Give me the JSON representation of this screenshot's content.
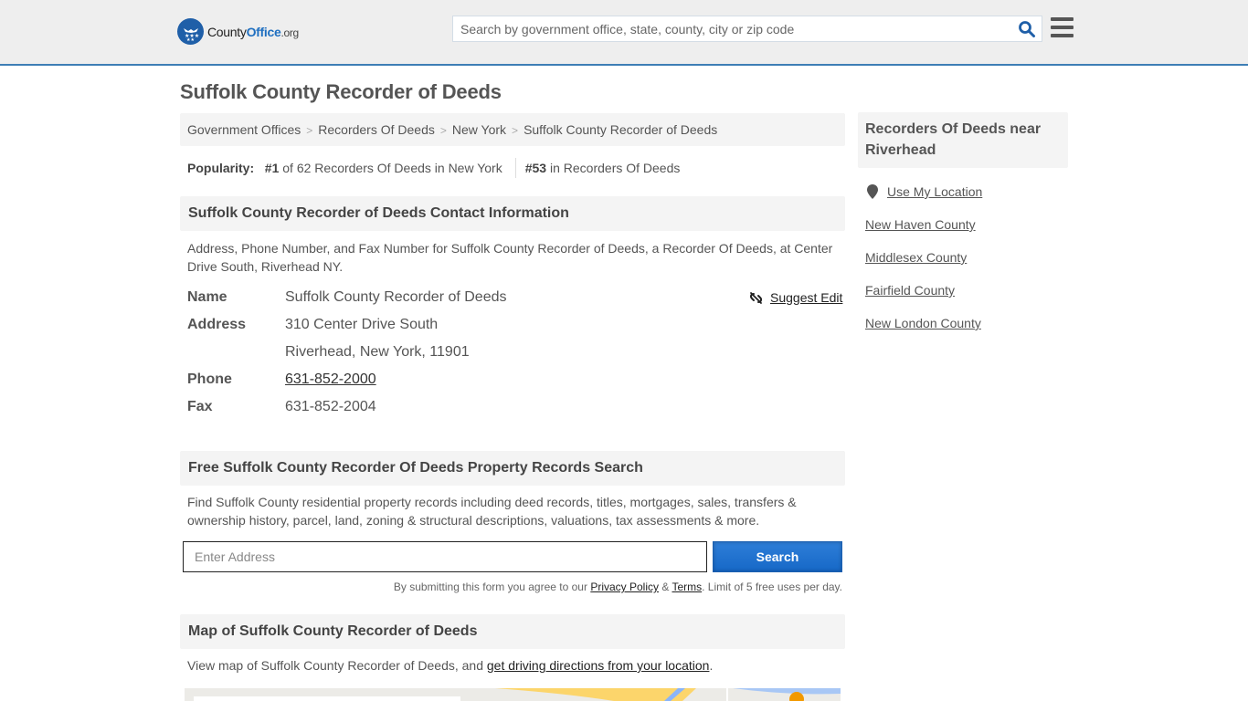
{
  "header": {
    "logo": {
      "county": "County",
      "office": "Office",
      "org": ".org"
    },
    "search_placeholder": "Search by government office, state, county, city or zip code",
    "brand_color": "#1f5fa8",
    "accent_border": "#3d7eb5"
  },
  "page": {
    "title": "Suffolk County Recorder of Deeds"
  },
  "breadcrumb": [
    {
      "label": "Government Offices"
    },
    {
      "label": "Recorders Of Deeds"
    },
    {
      "label": "New York"
    },
    {
      "label": "Suffolk County Recorder of Deeds"
    }
  ],
  "popularity": {
    "label": "Popularity:",
    "state_rank": "#1",
    "state_text": "of 62 Recorders Of Deeds in New York",
    "national_rank": "#53",
    "national_text": "in Recorders Of Deeds"
  },
  "contact": {
    "heading": "Suffolk County Recorder of Deeds Contact Information",
    "description": "Address, Phone Number, and Fax Number for Suffolk County Recorder of Deeds, a Recorder Of Deeds, at Center Drive South, Riverhead NY.",
    "suggest_edit": "Suggest Edit",
    "rows": {
      "name_label": "Name",
      "name_value": "Suffolk County Recorder of Deeds",
      "address_label": "Address",
      "address_line1": "310 Center Drive South",
      "address_line2": "Riverhead, New York, 11901",
      "phone_label": "Phone",
      "phone_value": "631-852-2000",
      "fax_label": "Fax",
      "fax_value": "631-852-2004"
    }
  },
  "property_search": {
    "heading": "Free Suffolk County Recorder Of Deeds Property Records Search",
    "description": "Find Suffolk County residential property records including deed records, titles, mortgages, sales, transfers & ownership history, parcel, land, zoning & structural descriptions, valuations, tax assessments & more.",
    "input_placeholder": "Enter Address",
    "input_value": "",
    "button_label": "Search",
    "button_color": "#1f74d0",
    "disclaimer_prefix": "By submitting this form you agree to our ",
    "privacy_link": "Privacy Policy",
    "amp": " & ",
    "terms_link": "Terms",
    "disclaimer_suffix": ". Limit of 5 free uses per day."
  },
  "map_section": {
    "heading": "Map of Suffolk County Recorder of Deeds",
    "text_prefix": "View map of Suffolk County Recorder of Deeds, and ",
    "directions_link": "get driving directions from your location",
    "text_suffix": "."
  },
  "sidebar": {
    "heading": "Recorders Of Deeds near Riverhead",
    "use_location": "Use My Location",
    "links": [
      {
        "label": "New Haven County"
      },
      {
        "label": "Middlesex County"
      },
      {
        "label": "Fairfield County"
      },
      {
        "label": "New London County"
      }
    ]
  }
}
